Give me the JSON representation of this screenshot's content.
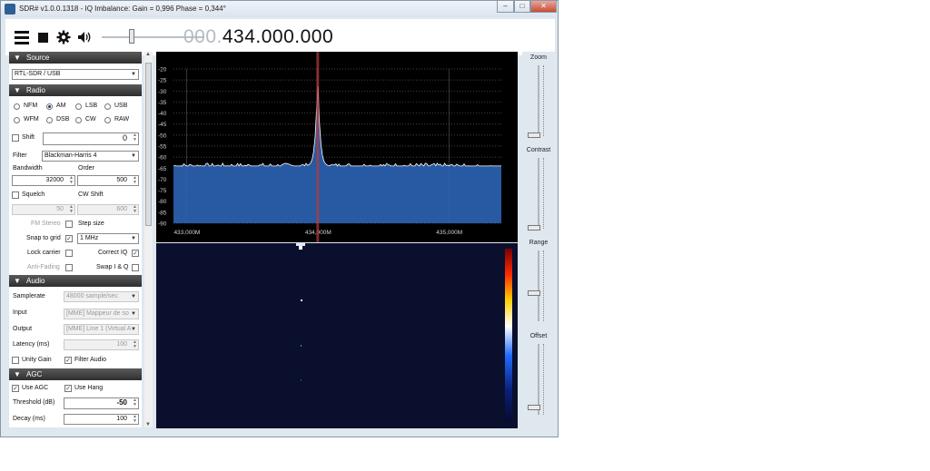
{
  "window": {
    "title": "SDR# v1.0.0.1318 - IQ Imbalance: Gain = 0,996 Phase = 0,344°",
    "buttons": {
      "minimize": "–",
      "maximize": "□",
      "close": "✕"
    }
  },
  "toolbar": {
    "icons": [
      "menu-icon",
      "stop-icon",
      "gear-icon",
      "speaker-icon"
    ],
    "volume_level": 0.3,
    "frequency_prefix": "000.",
    "frequency_main": "434.000.000"
  },
  "source": {
    "header": "Source",
    "device": "RTL-SDR / USB"
  },
  "radio": {
    "header": "Radio",
    "modes": [
      {
        "label": "NFM",
        "checked": false
      },
      {
        "label": "AM",
        "checked": true
      },
      {
        "label": "LSB",
        "checked": false
      },
      {
        "label": "USB",
        "checked": false
      },
      {
        "label": "WFM",
        "checked": false
      },
      {
        "label": "DSB",
        "checked": false
      },
      {
        "label": "CW",
        "checked": false
      },
      {
        "label": "RAW",
        "checked": false
      }
    ],
    "shift_label": "Shift",
    "shift_value": "0",
    "filter_label": "Filter",
    "filter_value": "Blackman-Harris 4",
    "bandwidth_label": "Bandwidth",
    "bandwidth_value": "32000",
    "order_label": "Order",
    "order_value": "500",
    "squelch_label": "Squelch",
    "cw_shift_label": "CW Shift",
    "squelch_value": "50",
    "cw_shift_value": "600",
    "fm_stereo_label": "FM Stereo",
    "step_size_label": "Step size",
    "snap_label": "Snap to grid",
    "snap_checked": true,
    "step_value": "1 MHz",
    "lock_carrier_label": "Lock carrier",
    "correct_iq_label": "Correct IQ",
    "correct_iq_checked": true,
    "anti_fading_label": "Anti-Fading",
    "swap_iq_label": "Swap I & Q"
  },
  "audio": {
    "header": "Audio",
    "samplerate_label": "Samplerate",
    "samplerate_value": "48000 sample/sec",
    "input_label": "Input",
    "input_value": "[MME] Mappeur de so",
    "output_label": "Output",
    "output_value": "[MME] Line 1 (Virtual A",
    "latency_label": "Latency (ms)",
    "latency_value": "100",
    "unity_gain_label": "Unity Gain",
    "filter_audio_label": "Filter Audio",
    "filter_audio_checked": true
  },
  "agc": {
    "header": "AGC",
    "use_agc_label": "Use AGC",
    "use_agc_checked": true,
    "use_hang_label": "Use Hang",
    "use_hang_checked": true,
    "threshold_label": "Threshold (dB)",
    "threshold_value": "-50",
    "decay_label": "Decay (ms)",
    "decay_value": "100"
  },
  "spectrum": {
    "y_ticks": [
      "-20",
      "-25",
      "-30",
      "-35",
      "-40",
      "-45",
      "-50",
      "-55",
      "-60",
      "-65",
      "-70",
      "-75",
      "-80",
      "-85",
      "-90"
    ],
    "x_ticks": [
      "433,000M",
      "434,000M",
      "435,000M"
    ],
    "y_range": [
      -90,
      -20
    ],
    "x_range_mhz": [
      432.9,
      435.4
    ],
    "center_mhz": 434.0,
    "noise_floor_db": -64,
    "peak_db": -24,
    "fill_color": "#2c63b5",
    "line_color": "#ffffff",
    "marker_color": "#b33a3a"
  },
  "side_controls": {
    "zoom_label": "Zoom",
    "contrast_label": "Contrast",
    "range_label": "Range",
    "offset_label": "Offset"
  }
}
